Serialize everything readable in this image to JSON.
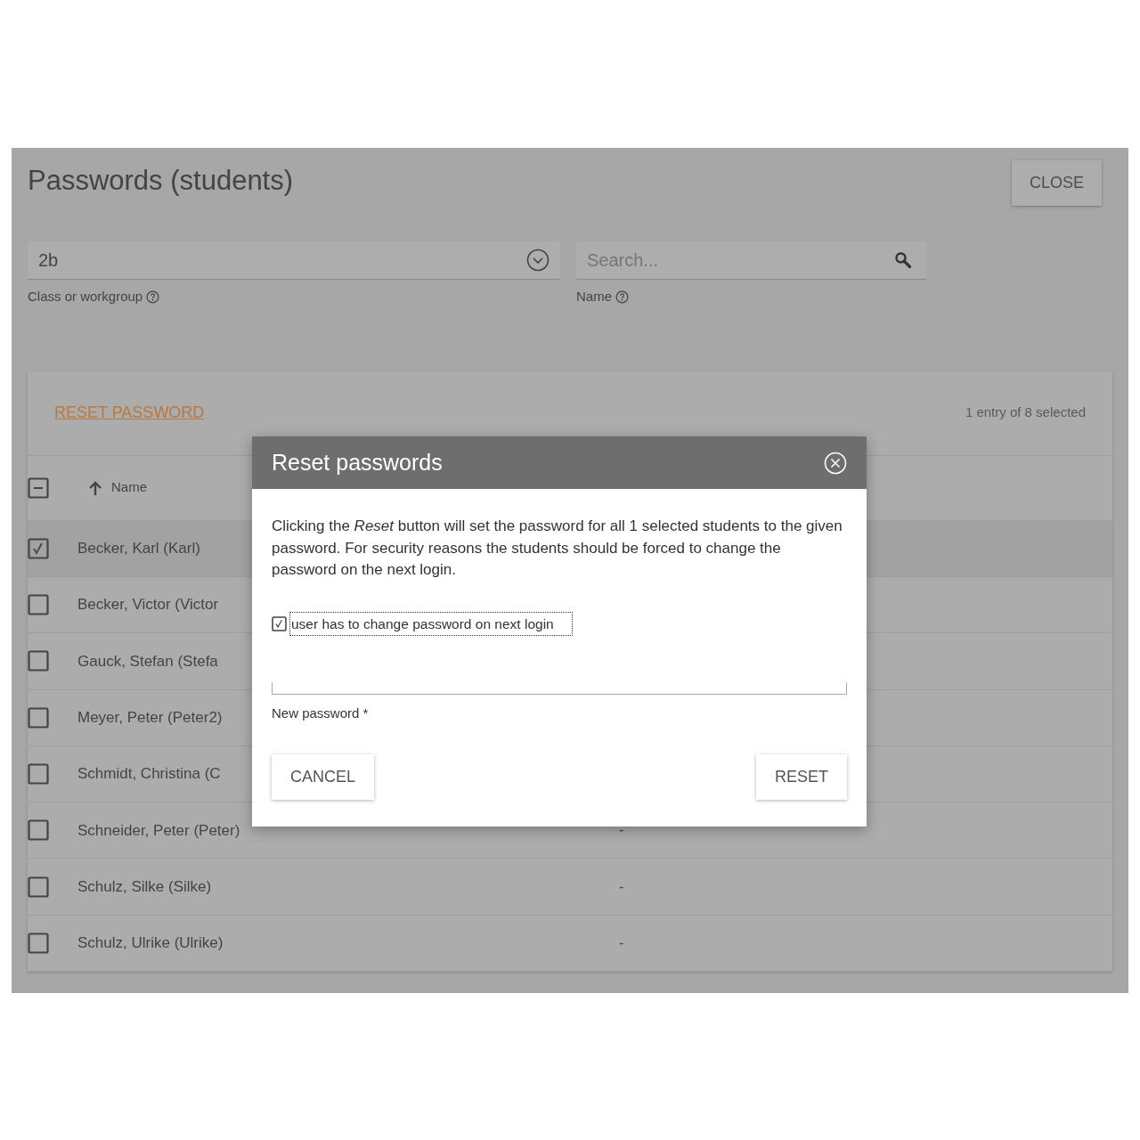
{
  "page": {
    "title": "Passwords (students)",
    "close_button": "CLOSE"
  },
  "filters": {
    "class_field": {
      "value": "2b",
      "helper": "Class or workgroup"
    },
    "search_field": {
      "placeholder": "Search...",
      "helper": "Name"
    }
  },
  "table": {
    "action": "RESET PASSWORD",
    "selection_info": "1 entry of 8 selected",
    "select_all_indeterminate": true,
    "columns": [
      {
        "label": "Name",
        "sorted_ascending": true
      }
    ],
    "rows": [
      {
        "name": "Becker, Karl (Karl)",
        "selected": true
      },
      {
        "name": "Becker, Victor (Victor",
        "selected": false
      },
      {
        "name": "Gauck, Stefan (Stefa",
        "selected": false
      },
      {
        "name": "Meyer, Peter (Peter2)",
        "selected": false
      },
      {
        "name": "Schmidt, Christina (C",
        "selected": false
      },
      {
        "name": "Schneider, Peter (Peter)",
        "selected": false,
        "column_2": "-"
      },
      {
        "name": "Schulz, Silke (Silke)",
        "selected": false,
        "column_2": "-"
      },
      {
        "name": "Schulz, Ulrike (Ulrike)",
        "selected": false,
        "column_2": "-"
      }
    ]
  },
  "dialog": {
    "title": "Reset passwords",
    "message": "Clicking the *Reset* button will set the password for all 1 selected students to the given password. For security reasons the students should be forced to change the password on the next login.",
    "checkbox": {
      "label": "user has to change password on next login",
      "checked": true
    },
    "password_field": {
      "label": "New password *"
    },
    "buttons": [
      "CANCEL",
      "RESET"
    ]
  }
}
